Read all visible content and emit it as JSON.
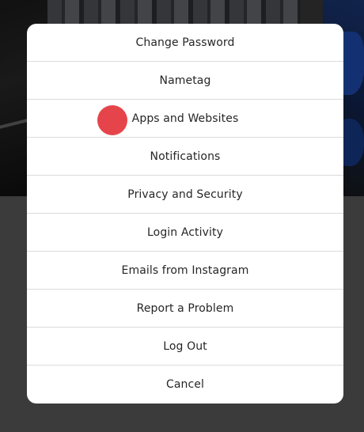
{
  "menu": {
    "items": [
      {
        "label": "Change Password"
      },
      {
        "label": "Nametag"
      },
      {
        "label": "Apps and Websites"
      },
      {
        "label": "Notifications"
      },
      {
        "label": "Privacy and Security"
      },
      {
        "label": "Login Activity"
      },
      {
        "label": "Emails from Instagram"
      },
      {
        "label": "Report a Problem"
      },
      {
        "label": "Log Out"
      },
      {
        "label": "Cancel"
      }
    ]
  },
  "colors": {
    "backdrop": "#5f5f5f",
    "modal_background": "#ffffff",
    "divider": "#dbdbdb",
    "text": "#262626",
    "click_marker": "#e5454a"
  }
}
